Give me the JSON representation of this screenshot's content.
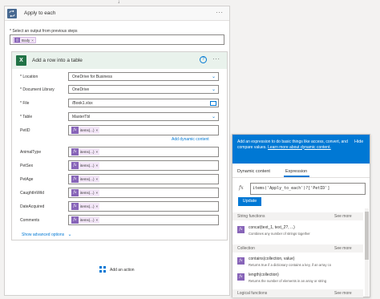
{
  "apply": {
    "title": "Apply to each",
    "more": "···",
    "select_label": "* Select an output from previous steps",
    "body_token": "Body",
    "token_x": "×"
  },
  "add_row": {
    "title": "Add a row into a table",
    "help": "?",
    "more": "···",
    "fields": [
      {
        "label": "* Location",
        "value": "OneDrive for Business",
        "kind": "dropdown"
      },
      {
        "label": "* Document Library",
        "value": "OneDrive",
        "kind": "dropdown"
      },
      {
        "label": "* File",
        "value": "/Book1.xlsx",
        "kind": "folder"
      },
      {
        "label": "* Table",
        "value": "MasterTbl",
        "kind": "dropdown"
      }
    ],
    "petid_label": "PetID",
    "dynamic_link": "Add dynamic content",
    "token_rows": [
      {
        "label": "AnimalType"
      },
      {
        "label": "PetSex"
      },
      {
        "label": "PetAge"
      },
      {
        "label": "CaughtInWild"
      },
      {
        "label": "DateAcquired"
      },
      {
        "label": "Comments"
      }
    ],
    "items_token": "items(...)",
    "token_x": "×",
    "advanced": "Show advanced options"
  },
  "add_action": "Add an action",
  "panel": {
    "banner_text": "Add an expression to do basic things like access, convert, and compare values.",
    "banner_link": "Learn more about dynamic content.",
    "hide": "Hide",
    "tab_dynamic": "Dynamic content",
    "tab_expression": "Expression",
    "fx": "fx",
    "expression": "items('Apply_to_each')?['PetID']",
    "update": "Update",
    "sections": [
      {
        "title": "String functions",
        "see_more": "See more",
        "items": [
          {
            "name": "concat(text_1, text_2?, ...)",
            "desc": "Combines any number of strings together"
          }
        ]
      },
      {
        "title": "Collection",
        "see_more": "See more",
        "items": [
          {
            "name": "contains(collection, value)",
            "desc": "Returns true if a dictionary contains a key, if an array co"
          },
          {
            "name": "length(collection)",
            "desc": "Returns the number of elements in an array or string"
          }
        ]
      },
      {
        "title": "Logical functions",
        "see_more": "See more",
        "items": []
      }
    ]
  },
  "colors": {
    "accent": "#0078d4",
    "excel": "#217346",
    "token": "#8764b8",
    "loop": "#486991"
  }
}
